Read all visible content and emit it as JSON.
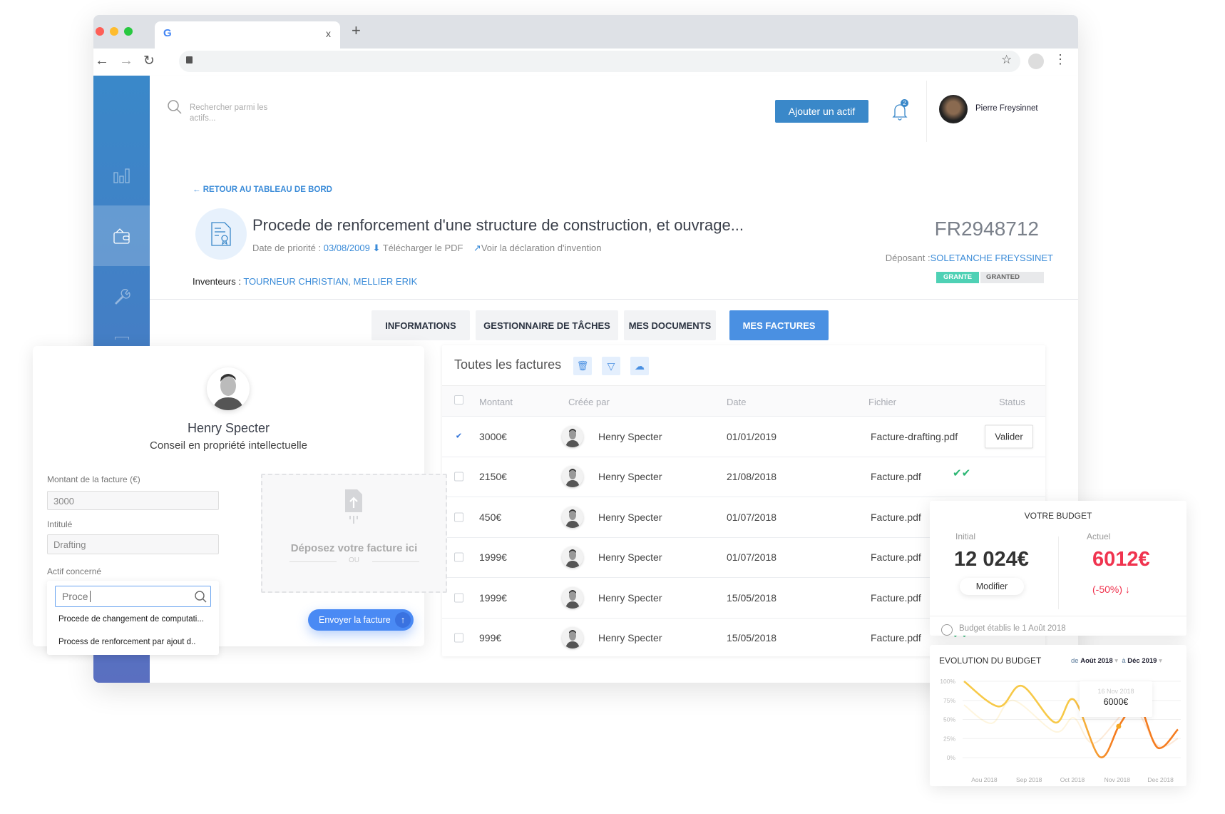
{
  "browser": {
    "tab_close": "x",
    "new_tab": "+"
  },
  "header": {
    "search_placeholder": "Rechercher parmi les actifs...",
    "add_button": "Ajouter un actif",
    "notification_count": "2",
    "user_name": "Pierre Freysinnet"
  },
  "sidebar": {
    "items": [
      {
        "icon": "bar-chart-icon"
      },
      {
        "icon": "wallet-icon",
        "active": true
      },
      {
        "icon": "wrench-icon"
      },
      {
        "icon": "briefcase-icon"
      }
    ]
  },
  "asset": {
    "back_link": "RETOUR AU TABLEAU DE BORD",
    "title": "Procede de renforcement d'une structure de construction, et ouvrage...",
    "priority_label": "Date de priorité :",
    "priority_date": "03/08/2009",
    "download_pdf": "Télécharger le PDF",
    "view_declaration": "Voir la déclaration d'invention",
    "number": "FR2948712",
    "applicant_label": "Déposant :",
    "applicant": "SOLETANCHE FREYSSINET",
    "inventors_label": "Inventeurs :",
    "inventors": "TOURNEUR CHRISTIAN, MELLIER ERIK",
    "badge_status": "GRANTE",
    "badge_status_en": "GRANTED"
  },
  "tabs": [
    {
      "label": "INFORMATIONS"
    },
    {
      "label": "GESTIONNAIRE DE TÂCHES"
    },
    {
      "label": "MES DOCUMENTS"
    },
    {
      "label": "MES FACTURES",
      "active": true
    }
  ],
  "invoices": {
    "title": "Toutes les factures",
    "columns": [
      "Montant",
      "Créée par",
      "Date",
      "Fichier",
      "Status"
    ],
    "rows": [
      {
        "checked": true,
        "amount": "3000€",
        "creator": "Henry Specter",
        "date": "01/01/2019",
        "file": "Facture-drafting.pdf",
        "status": "Valider"
      },
      {
        "checked": false,
        "amount": "2150€",
        "creator": "Henry Specter",
        "date": "21/08/2018",
        "file": "Facture.pdf",
        "status": "validated"
      },
      {
        "checked": false,
        "amount": "450€",
        "creator": "Henry Specter",
        "date": "01/07/2018",
        "file": "Facture.pdf",
        "status": "validated"
      },
      {
        "checked": false,
        "amount": "1999€",
        "creator": "Henry Specter",
        "date": "01/07/2018",
        "file": "Facture.pdf",
        "status": "validated"
      },
      {
        "checked": false,
        "amount": "1999€",
        "creator": "Henry Specter",
        "date": "15/05/2018",
        "file": "Facture.pdf",
        "status": "validated"
      },
      {
        "checked": false,
        "amount": "999€",
        "creator": "Henry Specter",
        "date": "15/05/2018",
        "file": "Facture.pdf",
        "status": "validated"
      }
    ]
  },
  "upload": {
    "name": "Henry Specter",
    "role": "Conseil en propriété intellectuelle",
    "amount_label": "Montant de la facture (€)",
    "amount_value": "3000",
    "title_label": "Intitulé",
    "title_value": "Drafting",
    "asset_label": "Actif concerné",
    "asset_search": "Proce",
    "suggestions": [
      "Procede de changement de computati...",
      "Process de renforcement par ajout d.."
    ],
    "drop_text": "Déposez votre facture ici",
    "or": "OU",
    "send_button": "Envoyer la facture"
  },
  "budget": {
    "title": "VOTRE BUDGET",
    "initial_label": "Initial",
    "initial_value": "12 024€",
    "modify": "Modifier",
    "current_label": "Actuel",
    "current_value": "6012€",
    "change": "(-50%) ↓",
    "established": "Budget établis le 1 Août 2018",
    "current_color": "#f0344f"
  },
  "chart_data": {
    "type": "line",
    "title": "EVOLUTION DU BUDGET",
    "from_label": "de",
    "from": "Août 2018",
    "to_label": "à",
    "to": "Déc 2019",
    "y_ticks": [
      "100%",
      "75%",
      "50%",
      "25%",
      "0%"
    ],
    "ylim": [
      0,
      100
    ],
    "x_ticks": [
      "Aou 2018",
      "Sep 2018",
      "Oct 2018",
      "Nov 2018",
      "Dec 2018"
    ],
    "grid": true,
    "series": [
      {
        "x": [
          "2018-08-01",
          "2018-08-25",
          "2018-09-10",
          "2018-10-03",
          "2018-10-16",
          "2018-11-03",
          "2018-11-16",
          "2018-11-25",
          "2018-12-01",
          "2018-12-13",
          "2018-12-27"
        ],
        "y": [
          100,
          67,
          94,
          46,
          76,
          1,
          41,
          66,
          68,
          13,
          37
        ]
      },
      {
        "x": [
          "2018-08-01",
          "2018-08-20",
          "2018-09-04",
          "2018-10-03",
          "2018-10-16",
          "2018-10-30",
          "2018-11-25",
          "2018-12-13",
          "2018-12-27"
        ],
        "y": [
          69,
          45,
          75,
          34,
          52,
          19,
          64,
          16,
          25
        ]
      }
    ],
    "tooltip": {
      "date": "16 Nov 2018",
      "value": "6000€"
    },
    "colors": [
      "#f7c948",
      "#f57c1f"
    ]
  }
}
